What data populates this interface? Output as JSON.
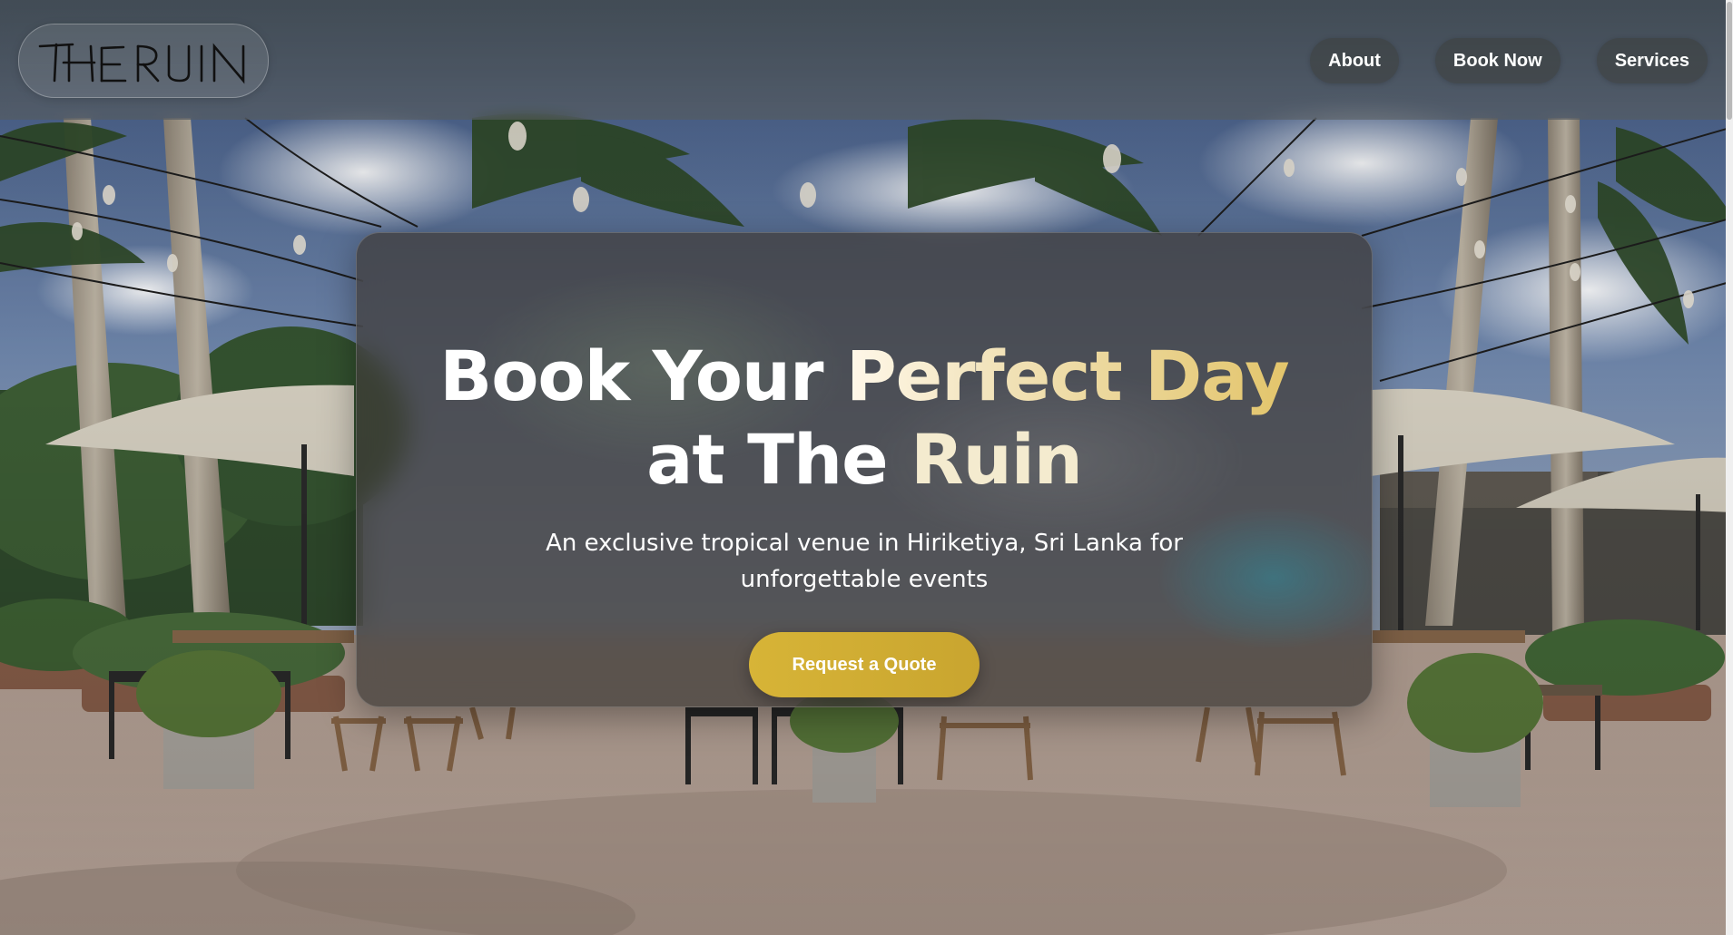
{
  "header": {
    "logo_text": "THE RUIN",
    "nav": [
      {
        "label": "About"
      },
      {
        "label": "Book Now"
      },
      {
        "label": "Services"
      }
    ]
  },
  "hero": {
    "title_part1": "Book Your ",
    "title_part2": "Perfect Day",
    "title_part3": "at The ",
    "title_part4": "Ruin",
    "subtitle": "An exclusive tropical venue in Hiriketiya, Sri Lanka for unforgettable events",
    "cta_label": "Request a Quote"
  },
  "colors": {
    "accent_gold": "#d4b137",
    "title_gold": "#e3c56b",
    "card_bg": "#3e3a38"
  }
}
